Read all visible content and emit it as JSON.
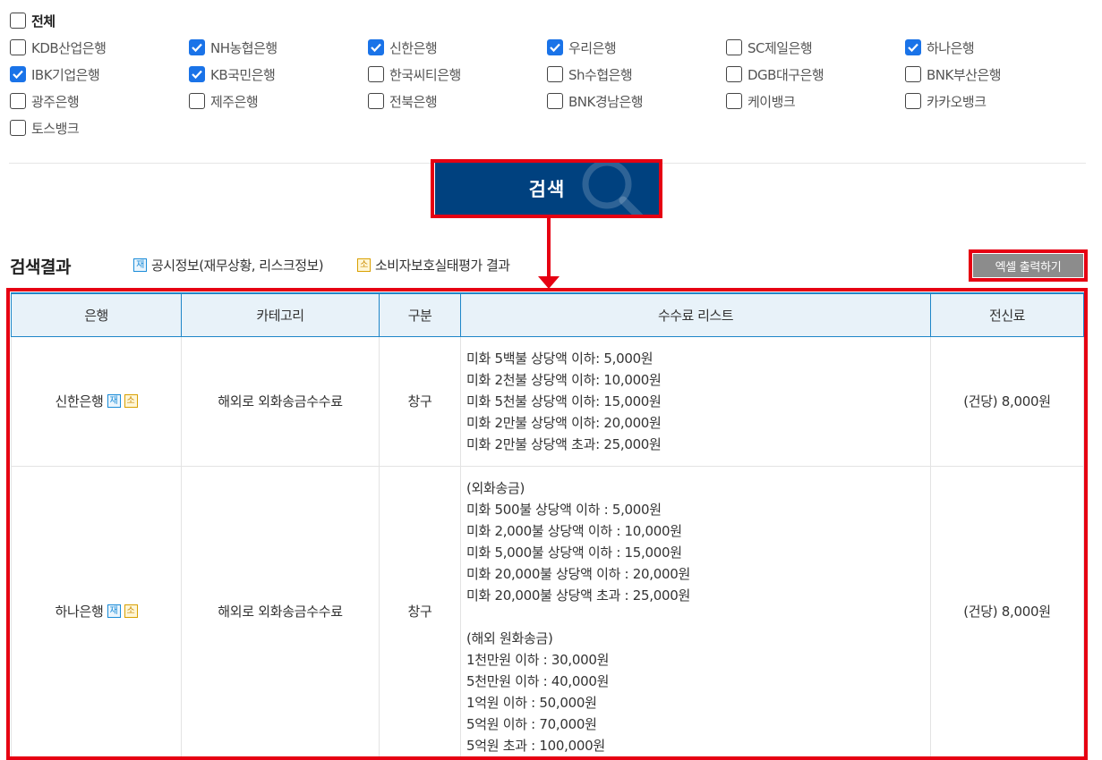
{
  "filters": {
    "all": {
      "label": "전체",
      "checked": false
    },
    "banks": [
      {
        "label": "KDB산업은행",
        "checked": false
      },
      {
        "label": "NH농협은행",
        "checked": true
      },
      {
        "label": "신한은행",
        "checked": true
      },
      {
        "label": "우리은행",
        "checked": true
      },
      {
        "label": "SC제일은행",
        "checked": false
      },
      {
        "label": "하나은행",
        "checked": true
      },
      {
        "label": "IBK기업은행",
        "checked": true
      },
      {
        "label": "KB국민은행",
        "checked": true
      },
      {
        "label": "한국씨티은행",
        "checked": false
      },
      {
        "label": "Sh수협은행",
        "checked": false
      },
      {
        "label": "DGB대구은행",
        "checked": false
      },
      {
        "label": "BNK부산은행",
        "checked": false
      },
      {
        "label": "광주은행",
        "checked": false
      },
      {
        "label": "제주은행",
        "checked": false
      },
      {
        "label": "전북은행",
        "checked": false
      },
      {
        "label": "BNK경남은행",
        "checked": false
      },
      {
        "label": "케이뱅크",
        "checked": false
      },
      {
        "label": "카카오뱅크",
        "checked": false
      },
      {
        "label": "토스뱅크",
        "checked": false
      }
    ]
  },
  "search": {
    "label": "검색"
  },
  "results": {
    "title": "검색결과",
    "legend_jae_tag": "재",
    "legend_jae_text": "공시정보(재무상황, 리스크정보)",
    "legend_so_tag": "소",
    "legend_so_text": "소비자보호실태평가 결과",
    "excel_label": "엑셀 출력하기"
  },
  "table": {
    "headers": [
      "은행",
      "카테고리",
      "구분",
      "수수료 리스트",
      "전신료"
    ],
    "rows": [
      {
        "bank": "신한은행",
        "tag1": "재",
        "tag2": "소",
        "category": "해외로 외화송금수수료",
        "type": "창구",
        "fees": [
          "미화 5백불 상당액 이하: 5,000원",
          "미화 2천불 상당액 이하: 10,000원",
          "미화 5천불 상당액 이하: 15,000원",
          "미화 2만불 상당액 이하: 20,000원",
          "미화 2만불 상당액 초과: 25,000원"
        ],
        "telegraph": "(건당) 8,000원"
      },
      {
        "bank": "하나은행",
        "tag1": "재",
        "tag2": "소",
        "category": "해외로 외화송금수수료",
        "type": "창구",
        "fees_a": [
          "(외화송금)",
          "미화 500불 상당액 이하 : 5,000원",
          "미화 2,000불 상당액 이하 : 10,000원",
          "미화 5,000불 상당액 이하 : 15,000원",
          "미화 20,000불 상당액 이하 : 20,000원",
          "미화 20,000불 상당액 초과 : 25,000원"
        ],
        "fees_b": [
          "(해외 원화송금)",
          "1천만원 이하 : 30,000원",
          "5천만원 이하 : 40,000원",
          "1억원 이하 : 50,000원",
          "5억원 이하 : 70,000원",
          "5억원 초과 : 100,000원"
        ],
        "telegraph": "(건당) 8,000원"
      }
    ]
  },
  "colors": {
    "primary": "#00417f",
    "highlight": "#e60012",
    "check": "#1a73e8",
    "header_bg": "#e8f2f9"
  }
}
